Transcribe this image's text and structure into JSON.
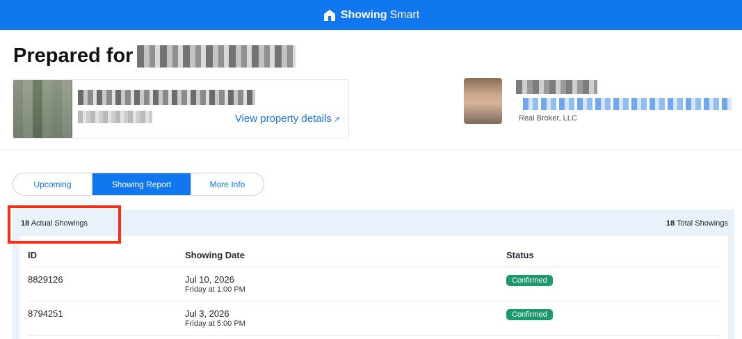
{
  "header": {
    "brand_bold": "Showing",
    "brand_light": "Smart"
  },
  "page": {
    "title": "Prepared for"
  },
  "property": {
    "view_details_label": "View property details",
    "view_details_arrow": "↗"
  },
  "agent": {
    "company": "Real Broker, LLC"
  },
  "tabs": [
    {
      "label": "Upcoming",
      "active": false
    },
    {
      "label": "Showing Report",
      "active": true
    },
    {
      "label": "More Info",
      "active": false
    }
  ],
  "summary": {
    "actual_count": "18",
    "actual_label": "Actual Showings",
    "total_count": "18",
    "total_label": "Total Showings"
  },
  "table": {
    "columns": [
      "ID",
      "Showing Date",
      "Status"
    ],
    "rows": [
      {
        "id": "8829126",
        "date": "Jul 10, 2026",
        "time": "Friday at 1:00 PM",
        "status": "Confirmed"
      },
      {
        "id": "8794251",
        "date": "Jul 3, 2026",
        "time": "Friday at 5:00 PM",
        "status": "Confirmed"
      }
    ]
  },
  "colors": {
    "primary": "#1177ee",
    "confirmed": "#1c9a6c",
    "highlight": "#ff2a12",
    "panel": "#e9f2fb"
  }
}
